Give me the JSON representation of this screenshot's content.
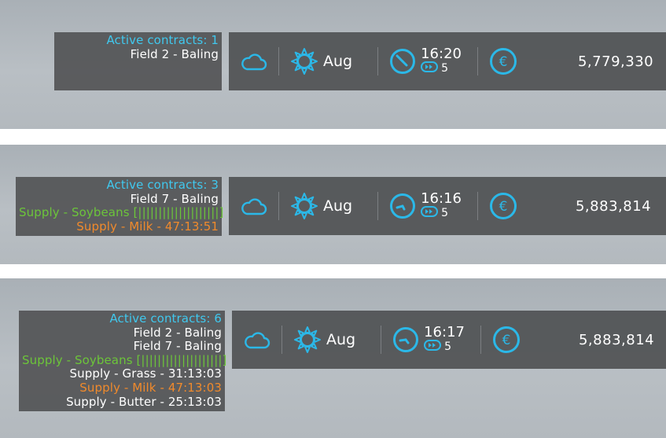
{
  "colors": {
    "accent": "#2bb8e8",
    "title": "#40c8ee",
    "supply_green": "#6cc53a",
    "supply_orange": "#f08a2c",
    "text": "#ffffff",
    "panel": "#525456"
  },
  "panels": [
    {
      "contracts": [
        {
          "text": "Active contracts: 1",
          "kind": "title"
        },
        {
          "text": "Field 2 - Baling",
          "kind": "white"
        }
      ],
      "hud": {
        "weather_icon": "cloud-icon",
        "season_icon": "sun-icon",
        "month": "Aug",
        "time": "16:20",
        "speed": "5",
        "currency_icon": "euro-icon",
        "money": "5,779,330"
      }
    },
    {
      "contracts": [
        {
          "text": "Active contracts: 3",
          "kind": "title"
        },
        {
          "text": "Field 7 - Baling",
          "kind": "white"
        },
        {
          "text": "Supply - Soybeans [||||||||||||||||||||]",
          "kind": "green"
        },
        {
          "text": "Supply - Milk - 47:13:51",
          "kind": "orange"
        }
      ],
      "hud": {
        "weather_icon": "cloud-icon",
        "season_icon": "sun-icon",
        "month": "Aug",
        "time": "16:16",
        "speed": "5",
        "currency_icon": "euro-icon",
        "money": "5,883,814"
      }
    },
    {
      "contracts": [
        {
          "text": "Active contracts: 6",
          "kind": "title"
        },
        {
          "text": "Field 2 - Baling",
          "kind": "white"
        },
        {
          "text": "Field 7 - Baling",
          "kind": "white"
        },
        {
          "text": "Supply - Soybeans [||||||||||||||||||||]",
          "kind": "green"
        },
        {
          "text": "Supply - Grass - 31:13:03",
          "kind": "white"
        },
        {
          "text": "Supply - Milk - 47:13:03",
          "kind": "orange"
        },
        {
          "text": "Supply - Butter - 25:13:03",
          "kind": "white"
        }
      ],
      "hud": {
        "weather_icon": "cloud-icon",
        "season_icon": "sun-icon",
        "month": "Aug",
        "time": "16:17",
        "speed": "5",
        "currency_icon": "euro-icon",
        "money": "5,883,814"
      }
    }
  ]
}
